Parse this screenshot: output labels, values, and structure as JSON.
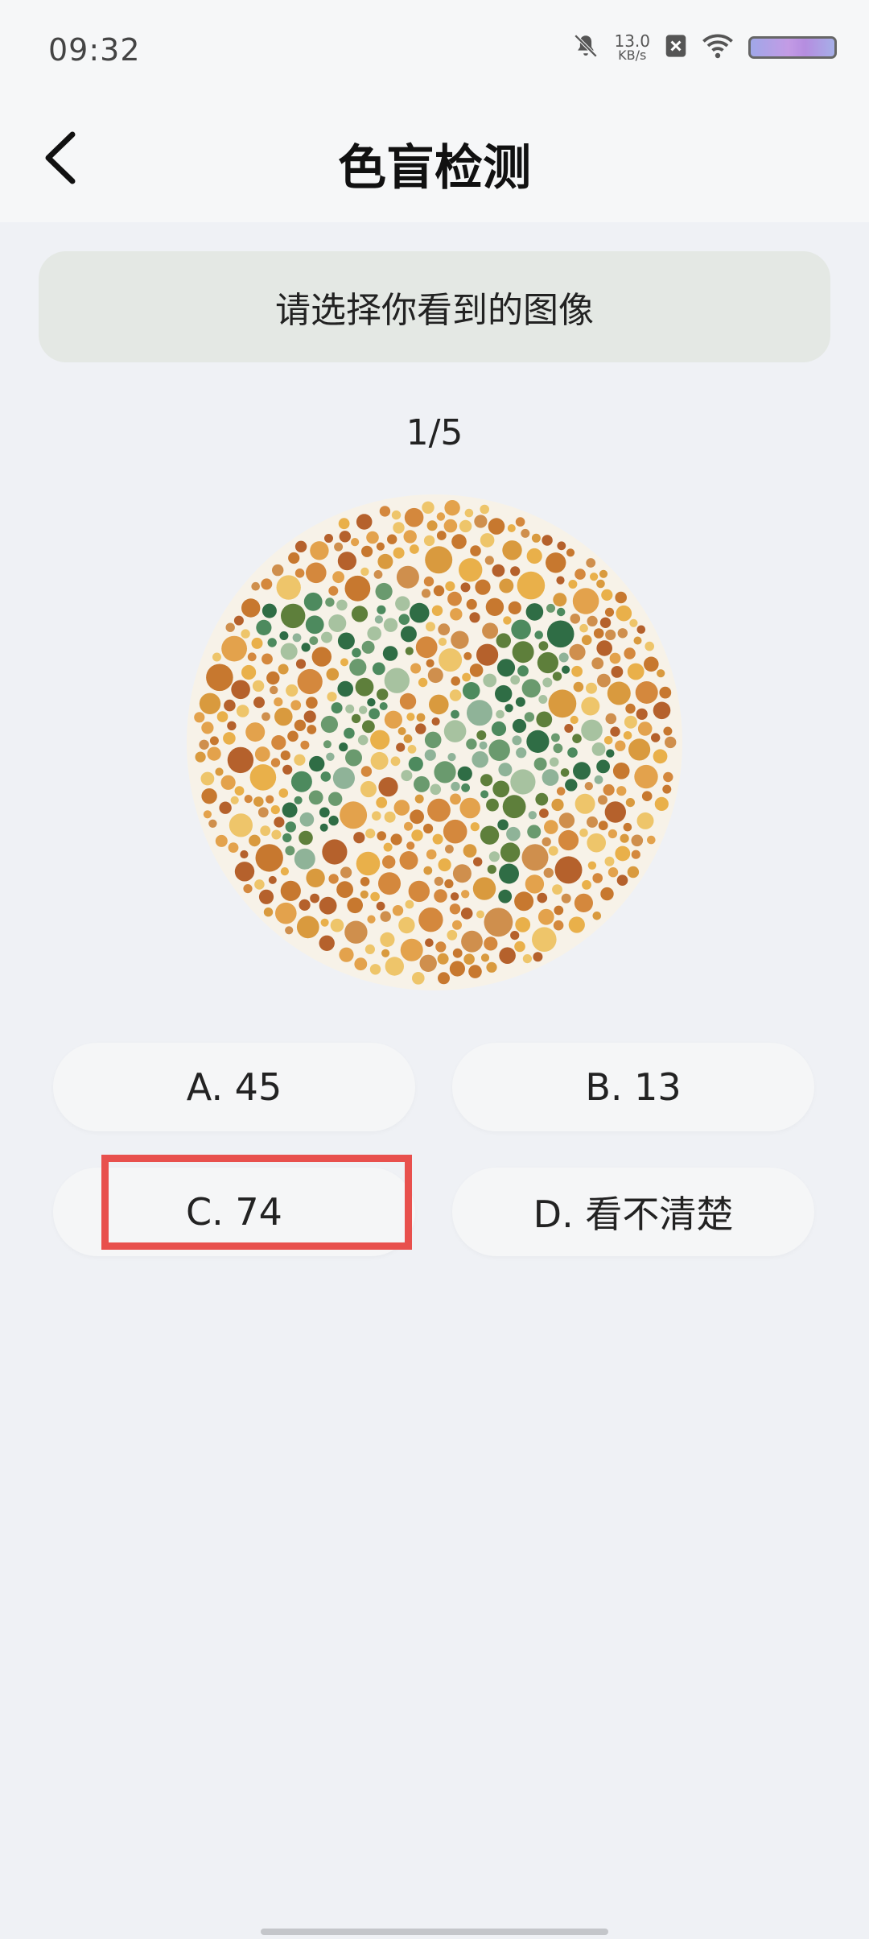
{
  "status_bar": {
    "time": "09:32",
    "net_speed_value": "13.0",
    "net_speed_unit": "KB/s",
    "icons": [
      "bell-muted-icon",
      "close-box-icon",
      "wifi-icon",
      "battery-icon"
    ]
  },
  "nav": {
    "title": "色盲检测",
    "back_icon": "chevron-left-icon"
  },
  "prompt": "请选择你看到的图像",
  "progress": "1/5",
  "plate": {
    "colors": {
      "background_dots": [
        "#e9b04a",
        "#d99a3e",
        "#c7782f",
        "#b5612c",
        "#e3a24c",
        "#d4883d",
        "#eec56a",
        "#cf8f4d"
      ],
      "figure_dots": [
        "#2f6d45",
        "#4d8a5e",
        "#8fb398",
        "#6a9a6e",
        "#5e7f3b",
        "#a7c2a0"
      ]
    }
  },
  "options": [
    {
      "label": "A. 45"
    },
    {
      "label": "B. 13"
    },
    {
      "label": "C. 74"
    },
    {
      "label": "D. 看不清楚"
    }
  ],
  "highlight_color": "#e8504d"
}
